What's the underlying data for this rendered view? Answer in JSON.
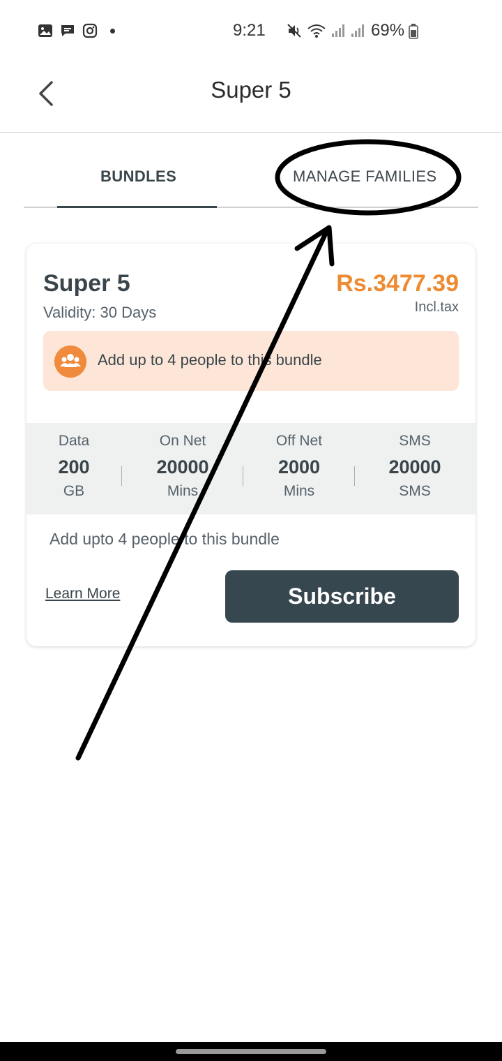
{
  "status_bar": {
    "time": "9:21",
    "battery": "69%",
    "left_icons": [
      "gallery-icon",
      "message-icon",
      "instagram-icon",
      "dot-icon"
    ],
    "right_icons": [
      "mute-icon",
      "wifi-icon",
      "signal-icon",
      "signal-icon",
      "battery-icon"
    ]
  },
  "header": {
    "title": "Super 5",
    "back_icon": "back-arrow-icon"
  },
  "tabs": [
    {
      "label": "BUNDLES",
      "active": true
    },
    {
      "label": "MANAGE FAMILIES",
      "active": false
    }
  ],
  "card": {
    "title": "Super 5",
    "validity": "Validity: 30 Days",
    "price": "Rs.3477.39",
    "tax_note": "Incl.tax",
    "banner_text": "Add up to 4 people to this bundle",
    "banner_icon": "people-icon",
    "stats": [
      {
        "label": "Data",
        "value": "200",
        "unit": "GB"
      },
      {
        "label": "On Net",
        "value": "20000",
        "unit": "Mins"
      },
      {
        "label": "Off Net",
        "value": "2000",
        "unit": "Mins"
      },
      {
        "label": "SMS",
        "value": "20000",
        "unit": "SMS"
      }
    ],
    "description": "Add upto 4 people to this bundle",
    "learn_more": "Learn More",
    "subscribe": "Subscribe"
  },
  "colors": {
    "accent": "#ee8a2f",
    "banner_bg": "#fde6d7",
    "button_bg": "#37474f",
    "stats_bg": "#eff0f0"
  }
}
